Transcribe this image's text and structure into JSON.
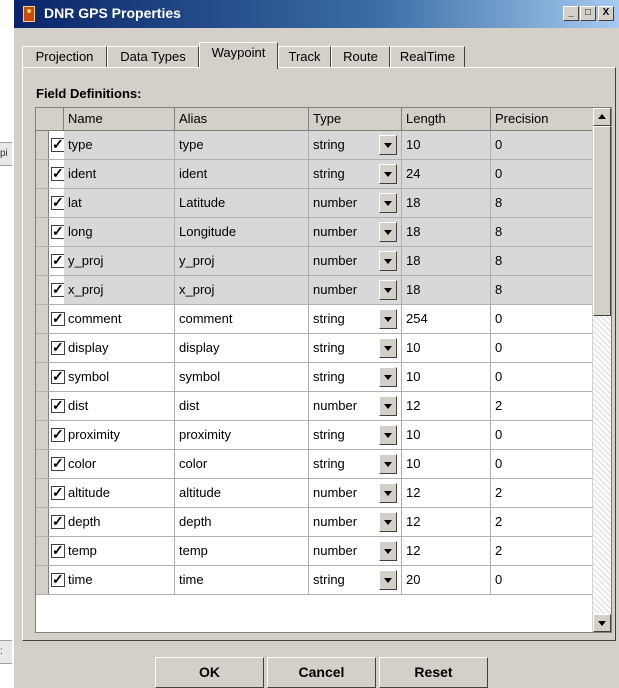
{
  "window": {
    "title": "DNR GPS Properties"
  },
  "titlebar_buttons": {
    "minimize": "_",
    "maximize": "□",
    "close": "X"
  },
  "background_marks": [
    "pi",
    ":"
  ],
  "tabs": [
    {
      "label": "Projection"
    },
    {
      "label": "Data Types"
    },
    {
      "label": "Waypoint",
      "active": true
    },
    {
      "label": "Track"
    },
    {
      "label": "Route"
    },
    {
      "label": "RealTime"
    }
  ],
  "field_definitions_label": "Field Definitions:",
  "columns": [
    "Name",
    "Alias",
    "Type",
    "Length",
    "Precision"
  ],
  "rows": [
    {
      "checked": true,
      "key": true,
      "name": "type",
      "alias": "type",
      "type": "string",
      "length": "10",
      "precision": "0"
    },
    {
      "checked": true,
      "key": true,
      "name": "ident",
      "alias": "ident",
      "type": "string",
      "length": "24",
      "precision": "0"
    },
    {
      "checked": true,
      "key": true,
      "name": "lat",
      "alias": "Latitude",
      "type": "number",
      "length": "18",
      "precision": "8"
    },
    {
      "checked": true,
      "key": true,
      "name": "long",
      "alias": "Longitude",
      "type": "number",
      "length": "18",
      "precision": "8"
    },
    {
      "checked": true,
      "key": true,
      "name": "y_proj",
      "alias": "y_proj",
      "type": "number",
      "length": "18",
      "precision": "8"
    },
    {
      "checked": true,
      "key": true,
      "name": "x_proj",
      "alias": "x_proj",
      "type": "number",
      "length": "18",
      "precision": "8"
    },
    {
      "checked": true,
      "key": false,
      "name": "comment",
      "alias": "comment",
      "type": "string",
      "length": "254",
      "precision": "0"
    },
    {
      "checked": true,
      "key": false,
      "name": "display",
      "alias": "display",
      "type": "string",
      "length": "10",
      "precision": "0"
    },
    {
      "checked": true,
      "key": false,
      "name": "symbol",
      "alias": "symbol",
      "type": "string",
      "length": "10",
      "precision": "0"
    },
    {
      "checked": true,
      "key": false,
      "name": "dist",
      "alias": "dist",
      "type": "number",
      "length": "12",
      "precision": "2"
    },
    {
      "checked": true,
      "key": false,
      "name": "proximity",
      "alias": "proximity",
      "type": "string",
      "length": "10",
      "precision": "0"
    },
    {
      "checked": true,
      "key": false,
      "name": "color",
      "alias": "color",
      "type": "string",
      "length": "10",
      "precision": "0"
    },
    {
      "checked": true,
      "key": false,
      "name": "altitude",
      "alias": "altitude",
      "type": "number",
      "length": "12",
      "precision": "2"
    },
    {
      "checked": true,
      "key": false,
      "name": "depth",
      "alias": "depth",
      "type": "number",
      "length": "12",
      "precision": "2"
    },
    {
      "checked": true,
      "key": false,
      "name": "temp",
      "alias": "temp",
      "type": "number",
      "length": "12",
      "precision": "2"
    },
    {
      "checked": true,
      "key": false,
      "name": "time",
      "alias": "time",
      "type": "string",
      "length": "20",
      "precision": "0"
    }
  ],
  "buttons": {
    "ok": "OK",
    "cancel": "Cancel",
    "reset": "Reset"
  },
  "colors": {
    "titlebar": "#0a246a",
    "face": "#d4d0c8",
    "key_row": "#d8d8d8"
  }
}
